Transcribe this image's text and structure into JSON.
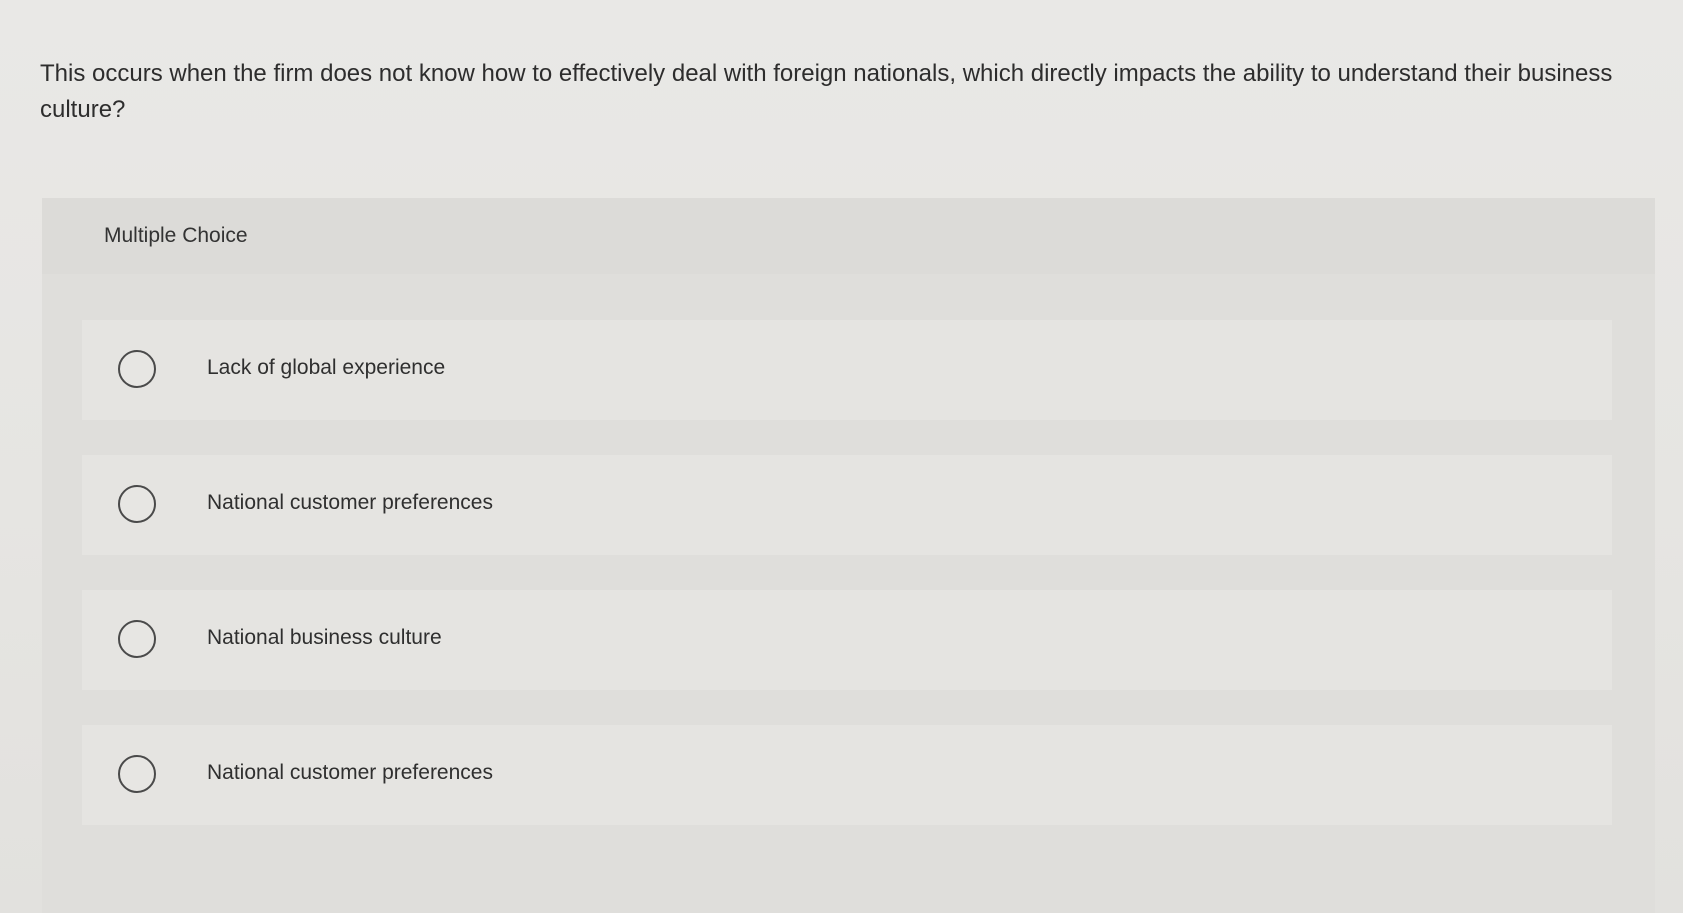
{
  "question": {
    "text": "This occurs when the firm does not know how to effectively deal with foreign nationals, which directly impacts the ability to understand their business culture?"
  },
  "panel": {
    "label": "Multiple Choice"
  },
  "options": [
    {
      "label": "Lack of global experience"
    },
    {
      "label": "National customer preferences"
    },
    {
      "label": "National business culture"
    },
    {
      "label": "National customer preferences"
    }
  ]
}
